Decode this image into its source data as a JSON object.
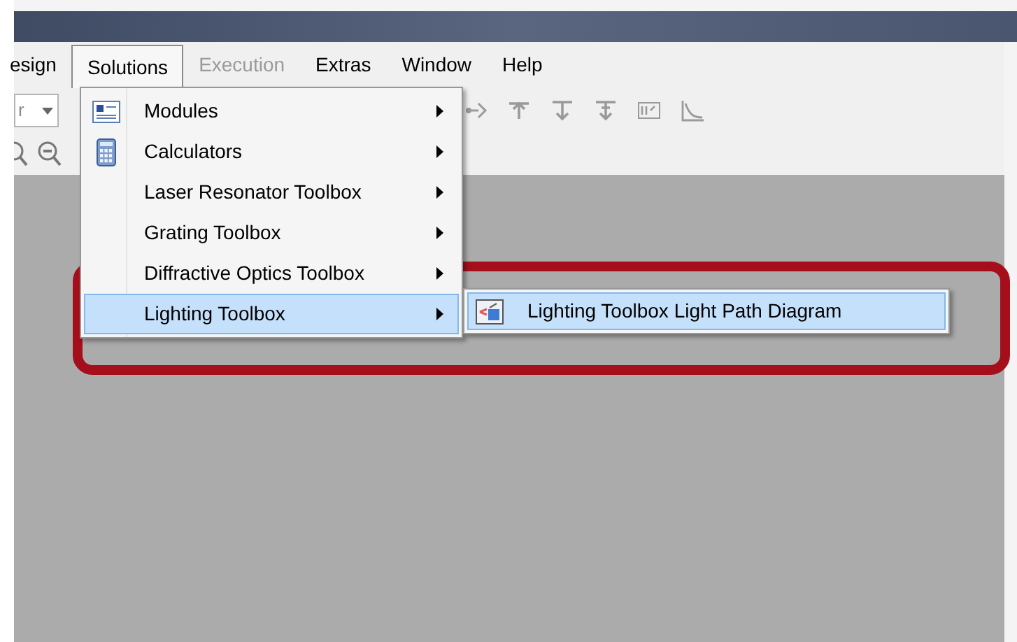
{
  "menu_bar": [
    {
      "label": "esign",
      "selected": false,
      "disabled": false
    },
    {
      "label": "Solutions",
      "selected": true,
      "disabled": false
    },
    {
      "label": "Execution",
      "selected": false,
      "disabled": true
    },
    {
      "label": "Extras",
      "selected": false,
      "disabled": false
    },
    {
      "label": "Window",
      "selected": false,
      "disabled": false
    },
    {
      "label": "Help",
      "selected": false,
      "disabled": false
    }
  ],
  "toolbar": {
    "combo_value": "r"
  },
  "solutions_menu": [
    {
      "label": "Modules",
      "kind": "document",
      "has_submenu": true,
      "selected": false
    },
    {
      "label": "Calculators",
      "kind": "calculator",
      "has_submenu": true,
      "selected": false
    },
    {
      "label": "Laser Resonator Toolbox",
      "has_submenu": true,
      "selected": false
    },
    {
      "label": "Grating Toolbox",
      "has_submenu": true,
      "selected": false
    },
    {
      "label": "Diffractive Optics Toolbox",
      "has_submenu": true,
      "selected": false
    },
    {
      "label": "Lighting Toolbox",
      "has_submenu": true,
      "selected": true
    }
  ],
  "submenu": [
    {
      "label": "Lighting Toolbox Light Path Diagram",
      "kind": "diagram",
      "selected": true
    }
  ],
  "annotation": {
    "kind": "highlight-frame",
    "color": "#a50f1c"
  }
}
